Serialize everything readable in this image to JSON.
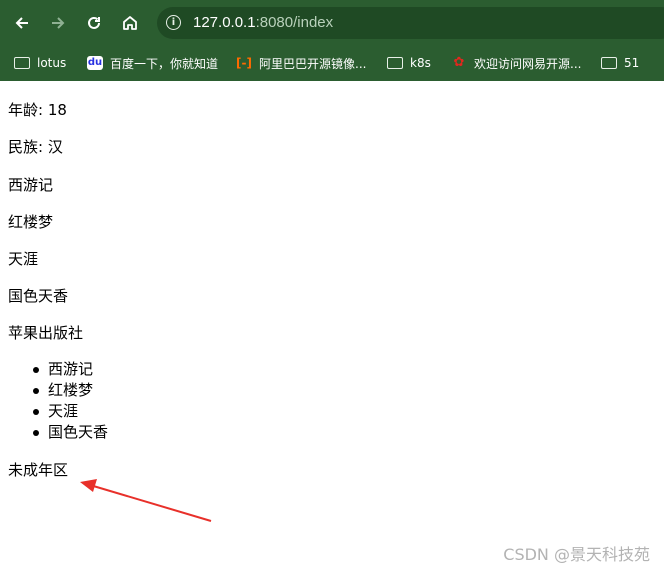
{
  "browser": {
    "url_host": "127.0.0.1",
    "url_rest": ":8080/index",
    "accent_color": "#2b5d30",
    "bookmarks": [
      {
        "label": "lotus",
        "icon": "folder-icon"
      },
      {
        "label": "百度一下，你就知道",
        "icon": "baidu-icon"
      },
      {
        "label": "阿里巴巴开源镜像...",
        "icon": "aliyun-icon"
      },
      {
        "label": "k8s",
        "icon": "folder-icon"
      },
      {
        "label": "欢迎访问网易开源...",
        "icon": "netease-icon"
      },
      {
        "label": "51",
        "icon": "folder-icon"
      }
    ]
  },
  "page": {
    "age_line": "年龄: 18",
    "ethnicity_line": "民族: 汉",
    "books": [
      "西游记",
      "红楼梦",
      "天涯",
      "国色天香"
    ],
    "publisher": "苹果出版社",
    "list_items": [
      "西游记",
      "红楼梦",
      "天涯",
      "国色天香"
    ],
    "minor_zone": "未成年区"
  },
  "annotation": {
    "arrow_color": "#e8302a"
  },
  "watermark": "CSDN @景天科技苑"
}
